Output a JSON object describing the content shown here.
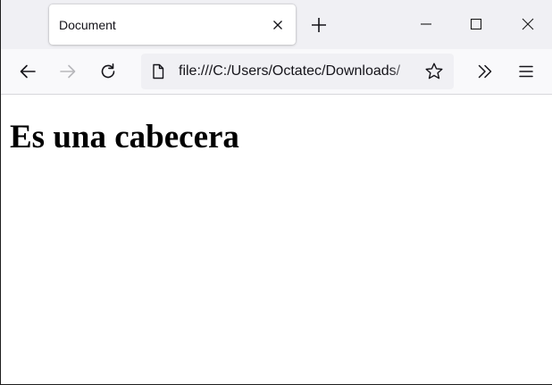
{
  "tab": {
    "title": "Document"
  },
  "urlbar": {
    "url": "file:///C:/Users/Octatec/Downloads/"
  },
  "content": {
    "heading": "Es una cabecera"
  },
  "icons": {
    "tab_close": "close-icon",
    "new_tab": "plus-icon",
    "minimize": "minimize-icon",
    "maximize": "maximize-icon",
    "window_close": "close-icon",
    "back": "arrow-left-icon",
    "forward": "arrow-right-icon",
    "reload": "reload-icon",
    "page": "page-icon",
    "bookmark": "star-icon",
    "overflow": "chevrons-right-icon",
    "menu": "hamburger-icon"
  },
  "colors": {
    "tabstrip": "#f0f0f4",
    "navbar": "#f9f9fb",
    "urlbar": "#f0f0f4",
    "text": "#15141a",
    "disabled": "#b7b7bb"
  }
}
